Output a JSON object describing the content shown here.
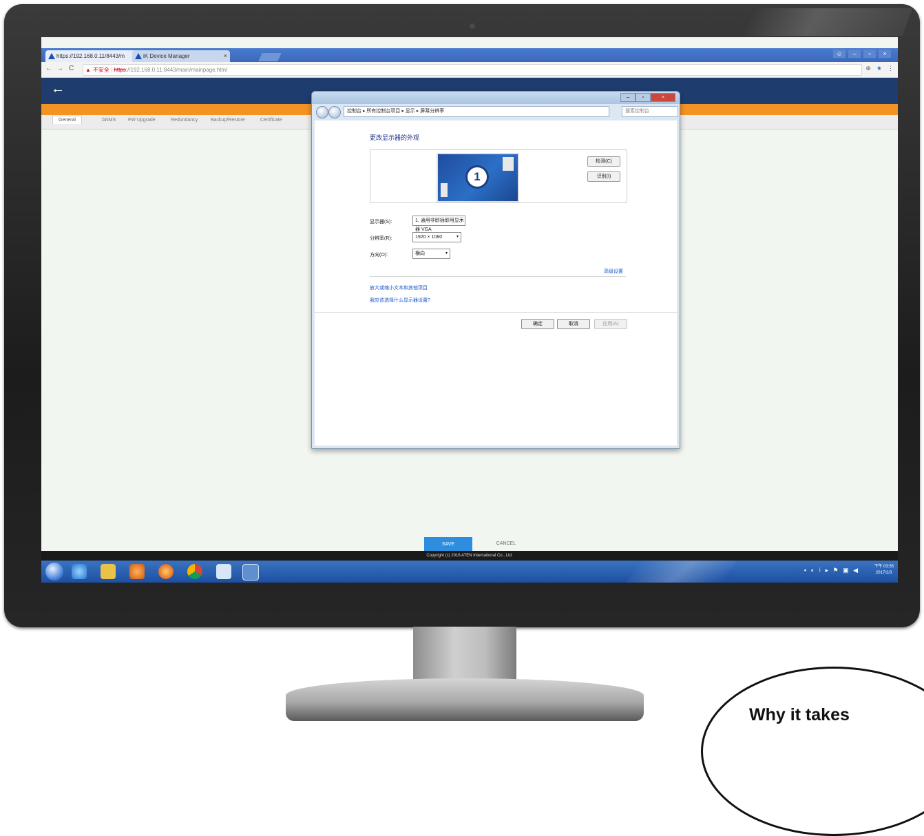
{
  "browser": {
    "tabs": [
      {
        "label": "https://192.168.0.11/8443/m"
      },
      {
        "label": "iK Device Manager"
      }
    ],
    "address": {
      "security_warning": "不安全",
      "scheme": "https",
      "url": "://192.168.0.11:8443/main/mainpage.html"
    }
  },
  "app": {
    "tabs": [
      "General",
      "ANMS",
      "FW Upgrade",
      "Redundancy",
      "Backup/Restore",
      "Certificate"
    ],
    "save_label": "SAVE",
    "cancel_label": "CANCEL",
    "footer": "Copyright (c) 2016 ATEN International Co., Ltd."
  },
  "dialog": {
    "breadcrumb": "控制台 ▸ 所有控制台项目 ▸ 显示 ▸ 屏幕分辨率",
    "search_placeholder": "搜索控制台",
    "heading": "更改显示器的外观",
    "monitor_number": "1",
    "detect_label": "检测(C)",
    "identify_label": "识别(I)",
    "fields": [
      {
        "label": "显示器(S):",
        "value": "1. 通用非即插即用显示器 VGA"
      },
      {
        "label": "分辨率(R):",
        "value": "1920 × 1080"
      },
      {
        "label": "方向(O):",
        "value": "横向"
      }
    ],
    "advanced_link": "高级设置",
    "links": [
      "放大或缩小文本和其他项目",
      "我应该选择什么显示器设置?"
    ],
    "ok_label": "确定",
    "cancel_label": "取消",
    "apply_label": "应用(A)"
  },
  "taskbar": {
    "time": "下午 03:55",
    "date": "2017/2/3"
  },
  "caption": {
    "text": "Why it takes"
  },
  "colors": {
    "app_header": "#1e3d6e",
    "accent_orange": "#f39324",
    "save_button": "#2d8ee0"
  }
}
